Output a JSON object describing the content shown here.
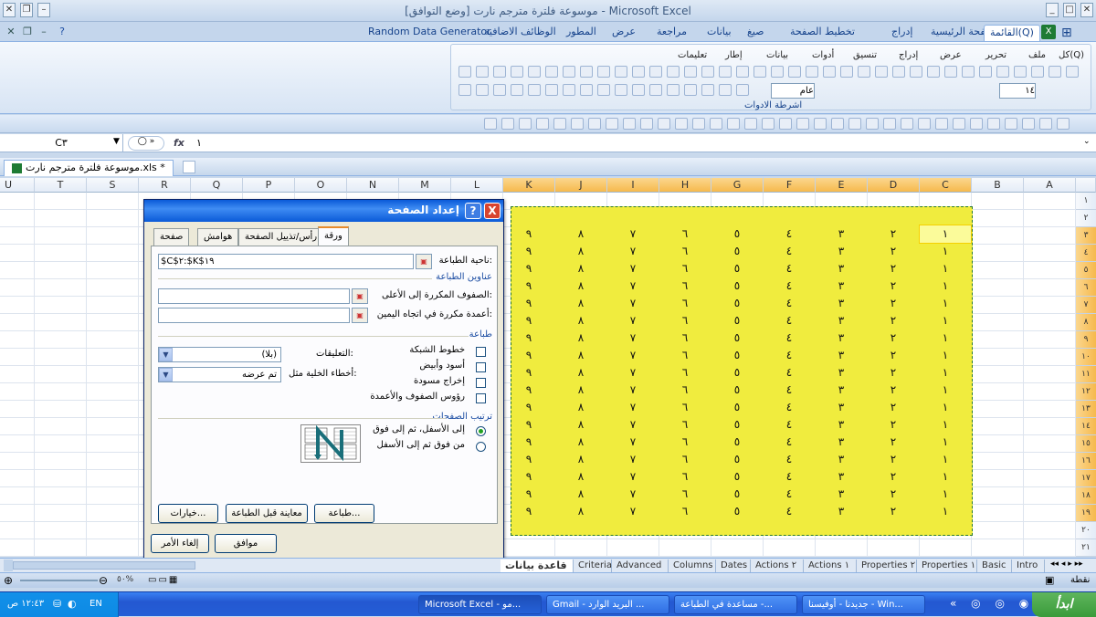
{
  "app": {
    "title": "موسوعة فلترة  مترجم نارت  [وضع التوافق] - Microsoft Excel"
  },
  "ribbon": {
    "tabs": [
      "القائمة(Q)",
      "الصفحة الرئيسية",
      "إدراج",
      "تخطيط الصفحة",
      "صيغ",
      "بيانات",
      "مراجعة",
      "عرض",
      "المطور",
      "الوظائف الاضافية",
      "Random Data Generator"
    ],
    "active_tab": "القائمة(Q)",
    "menus": [
      "كل(Q)",
      "ملف",
      "تحرير",
      "عرض",
      "إدراج",
      "تنسيق",
      "أدوات",
      "بيانات",
      "إطار",
      "تعليمات"
    ],
    "group_label": "اشرطة الادوات",
    "font_size": "١٤",
    "number_format": "عام"
  },
  "formula": {
    "namebox": "C٣",
    "fx": "fx",
    "value": "١"
  },
  "workbook": {
    "tab": "موسوعة فلترة  مترجم نارت.xls *"
  },
  "grid": {
    "columns": [
      "A",
      "B",
      "C",
      "D",
      "E",
      "F",
      "G",
      "H",
      "I",
      "J",
      "K",
      "L",
      "M",
      "N",
      "O",
      "P",
      "Q",
      "R",
      "S",
      "T",
      "U"
    ],
    "selected_columns": [
      "C",
      "D",
      "E",
      "F",
      "G",
      "H",
      "I",
      "J",
      "K"
    ],
    "rows": [
      "١",
      "٢",
      "٣",
      "٤",
      "٥",
      "٦",
      "٧",
      "٨",
      "٩",
      "١٠",
      "١١",
      "١٢",
      "١٣",
      "١٤",
      "١٥",
      "١٦",
      "١٧",
      "١٨",
      "١٩",
      "٢٠",
      "٢١"
    ],
    "row_values": [
      "١",
      "٢",
      "٣",
      "٤",
      "٥",
      "٦",
      "٧",
      "٨",
      "٩"
    ],
    "data_row_count": 17
  },
  "dialog": {
    "title": "إعداد الصفحة",
    "help": "?",
    "close": "X",
    "tabs": [
      "صفحة",
      "هوامش",
      "رأس/تذييل الصفحة",
      "ورقة"
    ],
    "active_tab": "ورقة",
    "print_area_label": "ناحية الطباعة:",
    "print_area_value": "$C$٢:$K$١٩",
    "print_titles_label": "عناوين الطباعة",
    "rows_repeat_label": "الصفوف المكررة إلى الأعلى:",
    "cols_repeat_label": "أعمدة مكررة في اتجاه اليمين:",
    "print_section": "طباعة",
    "checks": [
      {
        "label": "خطوط الشبكة",
        "checked": false
      },
      {
        "label": "أسود وأبيض",
        "checked": false
      },
      {
        "label": "إخراج مسودة",
        "checked": false
      },
      {
        "label": "رؤوس الصفوف والأعمدة",
        "checked": false
      }
    ],
    "comments_label": "التعليقات:",
    "comments_value": "(بلا)",
    "errors_label": "أخطاء الخلية مثل:",
    "errors_value": "تم عرضه",
    "page_order_section": "ترتيب الصفحات",
    "order_options": [
      {
        "label": "إلى الأسفل، ثم إلى فوق",
        "selected": true
      },
      {
        "label": "من فوق ثم إلى الأسفل",
        "selected": false
      }
    ],
    "btn_print": "طباعة...",
    "btn_preview": "معاينة قبل الطباعة",
    "btn_options": "خيارات...",
    "btn_ok": "موافق",
    "btn_cancel": "إلغاء الأمر"
  },
  "sheets": [
    "Intro",
    "Basic",
    "Properties ١",
    "Properties ٢",
    "Actions ١",
    "Actions ٢",
    "Dates",
    "Columns",
    "Advanced",
    "Criteria",
    "قاعدة بيانات"
  ],
  "active_sheet": "قاعدة بيانات",
  "status": {
    "ready": "نقطة",
    "zoom": "٥٠%"
  },
  "taskbar": {
    "start": "ابدأ",
    "tasks": [
      "جديدنا - أوفيسنا - Win...",
      "مساعدة في الطباعة -...",
      "Gmail - البريد الوارد ...",
      "Microsoft Excel - مو..."
    ],
    "lang": "EN",
    "clock": "١٢:٤٣ ص"
  },
  "colors": {
    "highlight": "#f0ec3e",
    "accent": "#1d4ea3"
  }
}
